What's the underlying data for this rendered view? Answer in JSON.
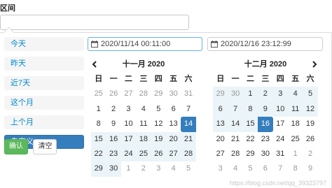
{
  "field": {
    "label": "区间"
  },
  "ranges": [
    {
      "label": "今天"
    },
    {
      "label": "昨天"
    },
    {
      "label": "近7天"
    },
    {
      "label": "这个月"
    },
    {
      "label": "上个月"
    },
    {
      "label": "自定义",
      "active": true
    }
  ],
  "buttons": {
    "apply": "确认",
    "clear": "清空"
  },
  "start_input": {
    "value": "2020/11/14 00:11:00",
    "icon": "calendar-icon"
  },
  "end_input": {
    "value": "2020/12/16 23:12:99",
    "icon": "calendar-icon"
  },
  "weekdays": [
    "日",
    "一",
    "二",
    "三",
    "四",
    "五",
    "六"
  ],
  "calendars": [
    {
      "title": "十一月 2020",
      "nav": "prev",
      "nav_icon": "chevron-left-icon",
      "weeks": [
        [
          "25",
          "26",
          "27",
          "28",
          "29",
          "30",
          "31"
        ],
        [
          "1",
          "2",
          "3",
          "4",
          "5",
          "6",
          "7"
        ],
        [
          "8",
          "9",
          "10",
          "11",
          "12",
          "13",
          "14"
        ],
        [
          "15",
          "16",
          "17",
          "18",
          "19",
          "20",
          "21"
        ],
        [
          "22",
          "23",
          "24",
          "25",
          "26",
          "27",
          "28"
        ],
        [
          "29",
          "30",
          "1",
          "2",
          "3",
          "4",
          "5"
        ]
      ]
    },
    {
      "title": "十二月 2020",
      "nav": "next",
      "nav_icon": "chevron-right-icon",
      "weeks": [
        [
          "29",
          "30",
          "1",
          "2",
          "3",
          "4",
          "5"
        ],
        [
          "6",
          "7",
          "8",
          "9",
          "10",
          "11",
          "12"
        ],
        [
          "13",
          "14",
          "15",
          "16",
          "17",
          "18",
          "19"
        ],
        [
          "20",
          "21",
          "22",
          "23",
          "24",
          "25",
          "26"
        ],
        [
          "27",
          "28",
          "29",
          "30",
          "31",
          "1",
          "2"
        ],
        [
          "3",
          "4",
          "5",
          "6",
          "7",
          "8",
          "9"
        ]
      ]
    }
  ],
  "watermark": "https://blog.csdn.net/qq_39323797",
  "colors": {
    "selected": "#357ebd",
    "in_range": "#ebf4f8",
    "apply": "#5cb85c",
    "link": "#0088cc"
  }
}
